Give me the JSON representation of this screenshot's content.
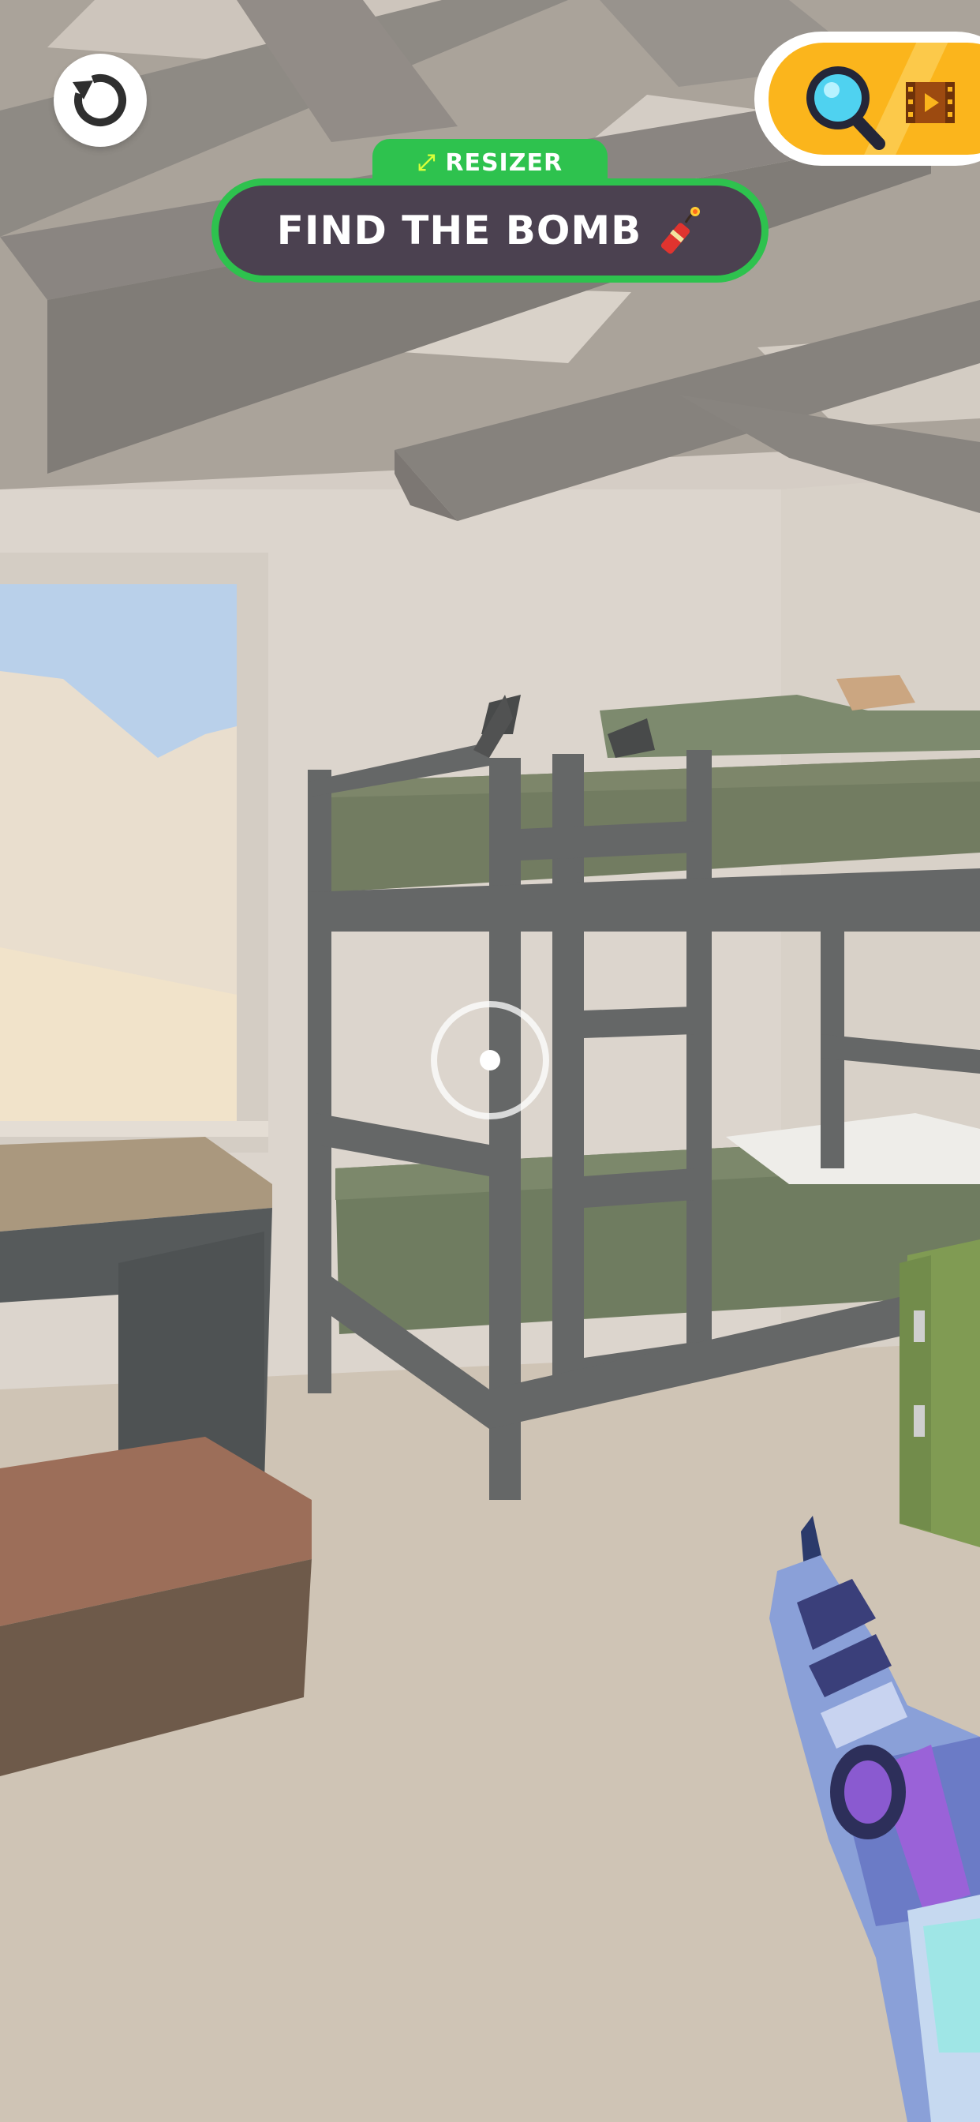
{
  "hud": {
    "mode_badge": "RESIZER",
    "objective": "FIND THE BOMB",
    "icons": {
      "restart": "restart-arrow-icon",
      "hint": "magnifier-icon",
      "ad": "video-icon",
      "objective_item": "dynamite-icon",
      "mode": "resize-arrows-icon"
    }
  },
  "colors": {
    "banner_border": "#2ec24e",
    "banner_fill": "#4b4150",
    "hint_pill": "#fbb51c",
    "crosshair": "#ffffff"
  }
}
